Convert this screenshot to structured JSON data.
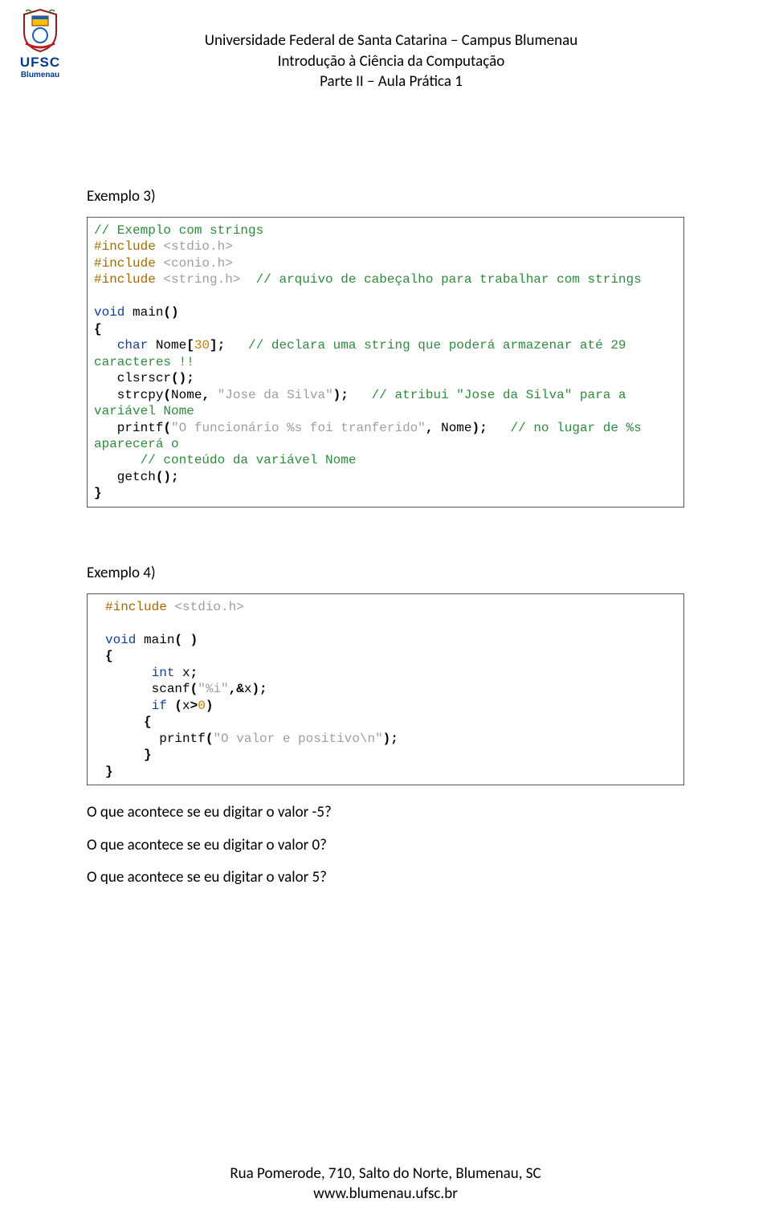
{
  "logo": {
    "ufsc": "UFSC",
    "blumenau": "Blumenau"
  },
  "header": {
    "line1": "Universidade Federal de Santa Catarina – Campus Blumenau",
    "line2": "Introdução à Ciência da Computação",
    "line3": "Parte II – Aula Prática 1"
  },
  "example3": {
    "label": "Exemplo 3)",
    "code": {
      "l1_comment": "// Exemplo com strings",
      "l2a": "#include ",
      "l2b": "<stdio.h>",
      "l3a": "#include ",
      "l3b": "<conio.h>",
      "l4a": "#include ",
      "l4b": "<string.h>",
      "l4c": "  // arquivo de cabeçalho para trabalhar com strings",
      "l6a": "void",
      "l6b": " main",
      "l6c": "()",
      "l7": "{",
      "l8a": "   ",
      "l8b": "char",
      "l8c": " Nome",
      "l8d": "[",
      "l8e": "30",
      "l8f": "];",
      "l8g": "   // declara uma string que poderá armazenar até 29",
      "l9": "caracteres !!",
      "l10a": "   clsrscr",
      "l10b": "();",
      "l11a": "   strcpy",
      "l11b": "(",
      "l11c": "Nome",
      "l11d": ",",
      "l11e": " \"Jose da Silva\"",
      "l11f": ");",
      "l11g": "   // atribui \"Jose da Silva\" para a",
      "l12": "variável Nome",
      "l13a": "   printf",
      "l13b": "(",
      "l13c": "\"O funcionário %s foi tranferido\"",
      "l13d": ",",
      "l13e": " Nome",
      "l13f": ");",
      "l13g": "   // no lugar de %s",
      "l14": "aparecerá o",
      "l15": "      // conteúdo da variável Nome",
      "l16a": "   getch",
      "l16b": "();",
      "l17": "}"
    }
  },
  "example4": {
    "label": "Exemplo 4)",
    "code": {
      "l1a": "#include ",
      "l1b": "<stdio.h>",
      "l3a": "void",
      "l3b": " main",
      "l3c": "( )",
      "l4": "{",
      "l5a": "      ",
      "l5b": "int",
      "l5c": " x",
      "l5d": ";",
      "l6a": "      scanf",
      "l6b": "(",
      "l6c": "\"%i\"",
      "l6d": ",&",
      "l6e": "x",
      "l6f": ");",
      "l7a": "      ",
      "l7b": "if",
      "l7c": " (",
      "l7d": "x",
      "l7e": ">",
      "l7f": "0",
      "l7g": ")",
      "l8": "     {",
      "l9a": "       printf",
      "l9b": "(",
      "l9c": "\"O valor e positivo\\n\"",
      "l9d": ");",
      "l10": "     }",
      "l11": "}"
    }
  },
  "questions": {
    "q1": "O que acontece se eu digitar o valor -5?",
    "q2": "O que acontece se eu digitar o valor 0?",
    "q3": "O que acontece se eu digitar o valor 5?"
  },
  "footer": {
    "line1": "Rua Pomerode, 710, Salto do Norte, Blumenau, SC",
    "line2": "www.blumenau.ufsc.br"
  }
}
